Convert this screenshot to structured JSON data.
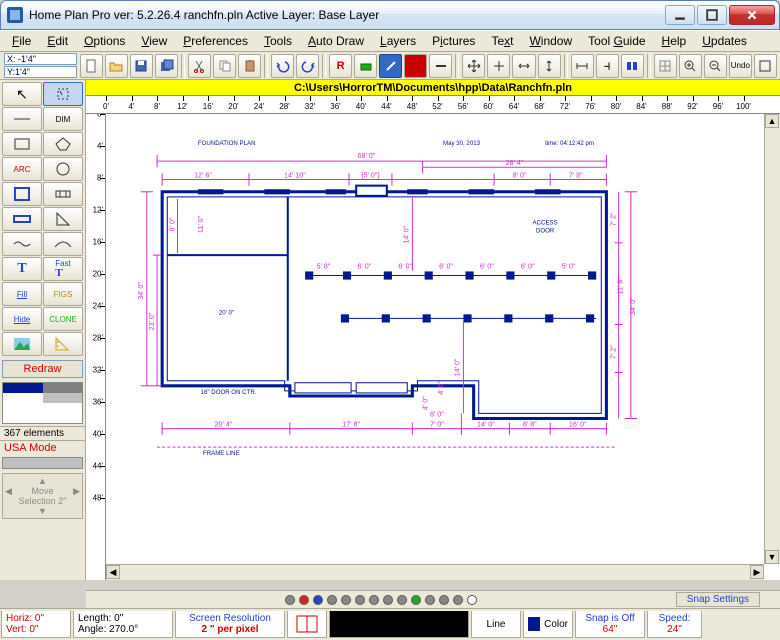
{
  "title": "Home Plan Pro ver: 5.2.26.4   ranchfn.pln             Active Layer: Base Layer",
  "menus": [
    "File",
    "Edit",
    "Options",
    "View",
    "Preferences",
    "Tools",
    "Auto Draw",
    "Layers",
    "Pictures",
    "Text",
    "Window",
    "Tool Guide",
    "Help",
    "Updates"
  ],
  "coords": {
    "x": "X: -1'4\"",
    "y": "Y:1'4\""
  },
  "toolbar_undo": "Undo",
  "path": "C:\\Users\\HorrorTM\\Documents\\hpp\\Data\\Ranchfn.pln",
  "ruler_ticks": [
    "0'",
    "4'",
    "8'",
    "12'",
    "16'",
    "20'",
    "24'",
    "28'",
    "32'",
    "36'",
    "40'",
    "44'",
    "48'",
    "52'",
    "56'",
    "60'",
    "64'",
    "68'",
    "72'",
    "76'",
    "80'",
    "84'",
    "88'",
    "92'",
    "96'",
    "100'"
  ],
  "vruler_ticks": [
    "0'",
    "4'",
    "8'",
    "12'",
    "16'",
    "20'",
    "24'",
    "28'",
    "32'",
    "36'",
    "40'",
    "44'",
    "48'"
  ],
  "tools": {
    "arrow": "↖",
    "dashsel": "⬚",
    "line": "—",
    "dim": "DIM",
    "rect": "▭",
    "poly": "⬠",
    "arc": "ARC",
    "circ": "○",
    "wall": "▤",
    "door": "◫",
    "wallseg": "▬",
    "tri": "◺",
    "curve": "∿",
    "curve2": "⌒",
    "text": "T",
    "fast": "Fast T",
    "fill": "Fill",
    "figs": "FIGS",
    "hide": "Hide",
    "clone": "CLONE",
    "img": "▦",
    "meas": "📐"
  },
  "redraw": "Redraw",
  "elements_count": "367 elements",
  "mode": "USA Mode",
  "move_sel": "Move Selection 2\"",
  "dims": {
    "w68": "68' 0\"",
    "w28_4": "28' 4\"",
    "w12_6": "12' 6\"",
    "w14_10": "14' 10\"",
    "w5": "{5' 0\"}",
    "w8_0": "8' 0\"",
    "w7_8": "7' 8\"",
    "h34": "34' 0\"",
    "h23": "23' 0\"",
    "h20": "20' 0\"",
    "h8": "8' 0\"",
    "h11": "11' 0\"",
    "s58": "5' 8\"",
    "s60": "6' 0\"",
    "s50": "5' 0\"",
    "h14": "14' 0\"",
    "h7_2": "7' 2\"",
    "h11_8": "11' 8\"",
    "b20_4": "20' 4\"",
    "b17_8": "17' 8\"",
    "b7": "7' 0\"",
    "b14": "14' 0\"",
    "b8_8": "8' 8\"",
    "b16": "16' 0\"",
    "h4": "4' 0\"",
    "h4_6": "4' 6\"",
    "title": "FOUNDATION PLAN",
    "date": "May 30, 2013",
    "time": "time: 04:12:42 pm",
    "frame": "FRAME LINE",
    "door_ctr": "16\" DOOR ON CTR.",
    "access": "ACCESS",
    "door": "DOOR"
  },
  "snap_settings": "Snap Settings",
  "status": {
    "horiz": "Horiz: 0\"",
    "vert": "Vert:  0\"",
    "length": "Length:  0\"",
    "angle": "Angle: 270.0°",
    "res_lbl": "Screen Resolution",
    "res_val": "2 \" per pixel",
    "line": "Line",
    "color": "Color",
    "snap": "Snap is Off",
    "snap_val": "64\"",
    "speed": "Speed:",
    "speed_val": "24\""
  }
}
